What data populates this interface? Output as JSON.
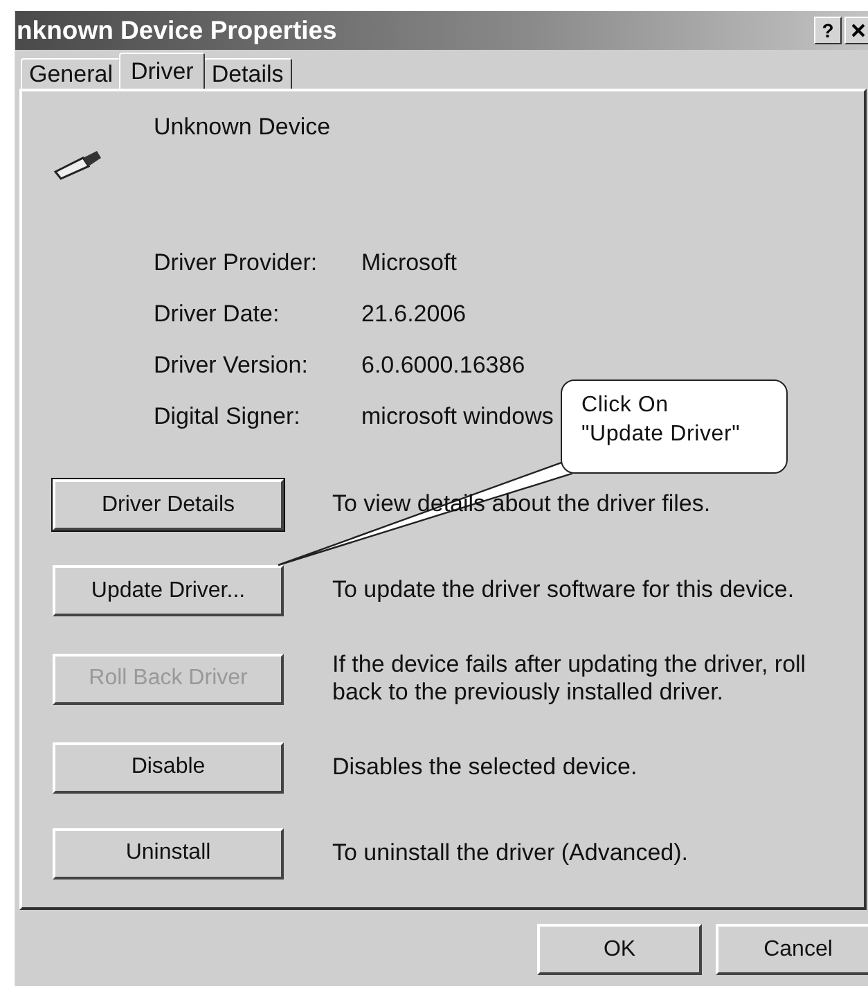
{
  "window": {
    "title": "nknown Device Properties",
    "help_button": "?"
  },
  "tabs": [
    {
      "label": "General",
      "selected": false
    },
    {
      "label": "Driver",
      "selected": true
    },
    {
      "label": "Details",
      "selected": false
    }
  ],
  "device": {
    "name": "Unknown Device"
  },
  "properties": [
    {
      "label": "Driver Provider:",
      "value": "Microsoft"
    },
    {
      "label": "Driver Date:",
      "value": "21.6.2006"
    },
    {
      "label": "Driver Version:",
      "value": "6.0.6000.16386"
    },
    {
      "label": "Digital Signer:",
      "value": "microsoft windows"
    }
  ],
  "actions": [
    {
      "label": "Driver Details",
      "description": "To view details about the driver files.",
      "disabled": false,
      "default": true
    },
    {
      "label": "Update Driver...",
      "description": "To update the driver software for this device.",
      "disabled": false,
      "default": false
    },
    {
      "label": "Roll Back Driver",
      "description": "If the device fails after updating the driver, roll back to the previously installed driver.",
      "disabled": true,
      "default": false
    },
    {
      "label": "Disable",
      "description": "Disables the selected device.",
      "disabled": false,
      "default": false
    },
    {
      "label": "Uninstall",
      "description": "To uninstall the driver (Advanced).",
      "disabled": false,
      "default": false
    }
  ],
  "callout": {
    "text": "Click On\n\"Update Driver\""
  },
  "buttons": [
    "OK",
    "Cancel"
  ]
}
